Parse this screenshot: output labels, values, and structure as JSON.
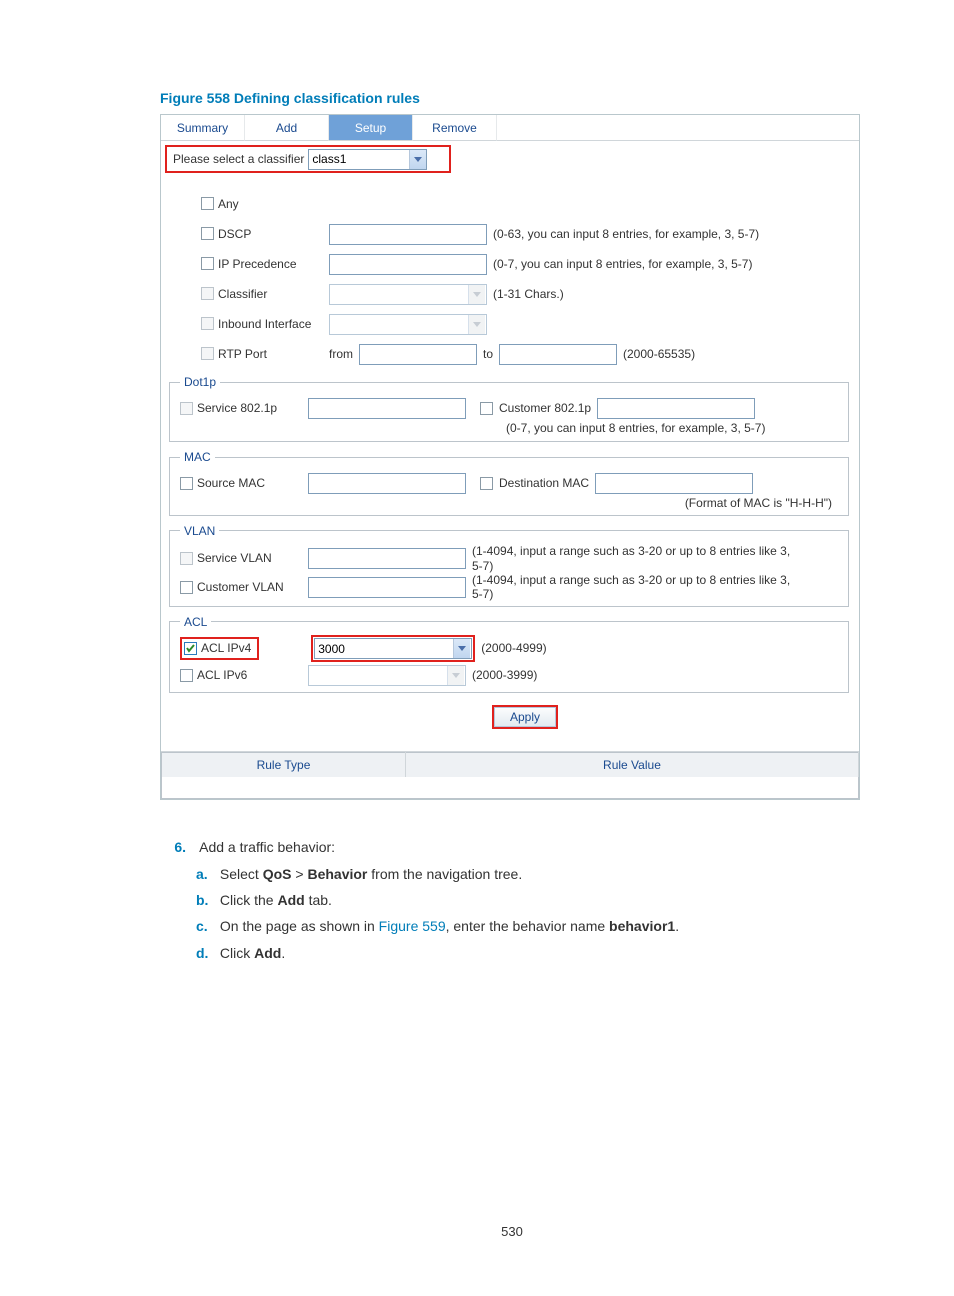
{
  "caption": "Figure 558 Defining classification rules",
  "tabs": {
    "summary": "Summary",
    "add": "Add",
    "setup": "Setup",
    "remove": "Remove"
  },
  "classifier": {
    "label": "Please select a classifier",
    "value": "class1"
  },
  "fields": {
    "any": "Any",
    "dscp": "DSCP",
    "dscp_hint": "(0-63, you can input 8 entries, for example, 3, 5-7)",
    "ipprec": "IP Precedence",
    "ipprec_hint": "(0-7, you can input 8 entries, for example, 3, 5-7)",
    "classifierLbl": "Classifier",
    "classifier_hint": "(1-31 Chars.)",
    "inbound": "Inbound Interface",
    "rtp": "RTP Port",
    "rtp_from": "from",
    "rtp_to": "to",
    "rtp_hint": "(2000-65535)"
  },
  "dot1p": {
    "legend": "Dot1p",
    "service": "Service 802.1p",
    "customer": "Customer 802.1p",
    "hint": "(0-7, you can input 8 entries, for example, 3, 5-7)"
  },
  "mac": {
    "legend": "MAC",
    "src": "Source MAC",
    "dst": "Destination MAC",
    "hint": "(Format of MAC is \"H-H-H\")"
  },
  "vlan": {
    "legend": "VLAN",
    "service": "Service VLAN",
    "customer": "Customer VLAN",
    "hint": "(1-4094, input a range such as 3-20 or up to 8 entries like 3, 5-7)"
  },
  "acl": {
    "legend": "ACL",
    "ipv4": "ACL IPv4",
    "ipv4_val": "3000",
    "ipv4_hint": "(2000-4999)",
    "ipv6": "ACL IPv6",
    "ipv6_hint": "(2000-3999)"
  },
  "apply": "Apply",
  "table": {
    "col1": "Rule Type",
    "col2": "Rule Value"
  },
  "steps": {
    "num": "6.",
    "title": "Add a traffic behavior:",
    "a_pre": "Select ",
    "a_b1": "QoS",
    "a_mid": " > ",
    "a_b2": "Behavior",
    "a_post": " from the navigation tree.",
    "b_pre": "Click the ",
    "b_b": "Add",
    "b_post": " tab.",
    "c_pre": "On the page as shown in ",
    "c_link": "Figure 559",
    "c_mid": ", enter the behavior name ",
    "c_b": "behavior1",
    "c_post": ".",
    "d_pre": "Click ",
    "d_b": "Add",
    "d_post": "."
  },
  "letters": {
    "a": "a.",
    "b": "b.",
    "c": "c.",
    "d": "d."
  },
  "pagenum": "530"
}
